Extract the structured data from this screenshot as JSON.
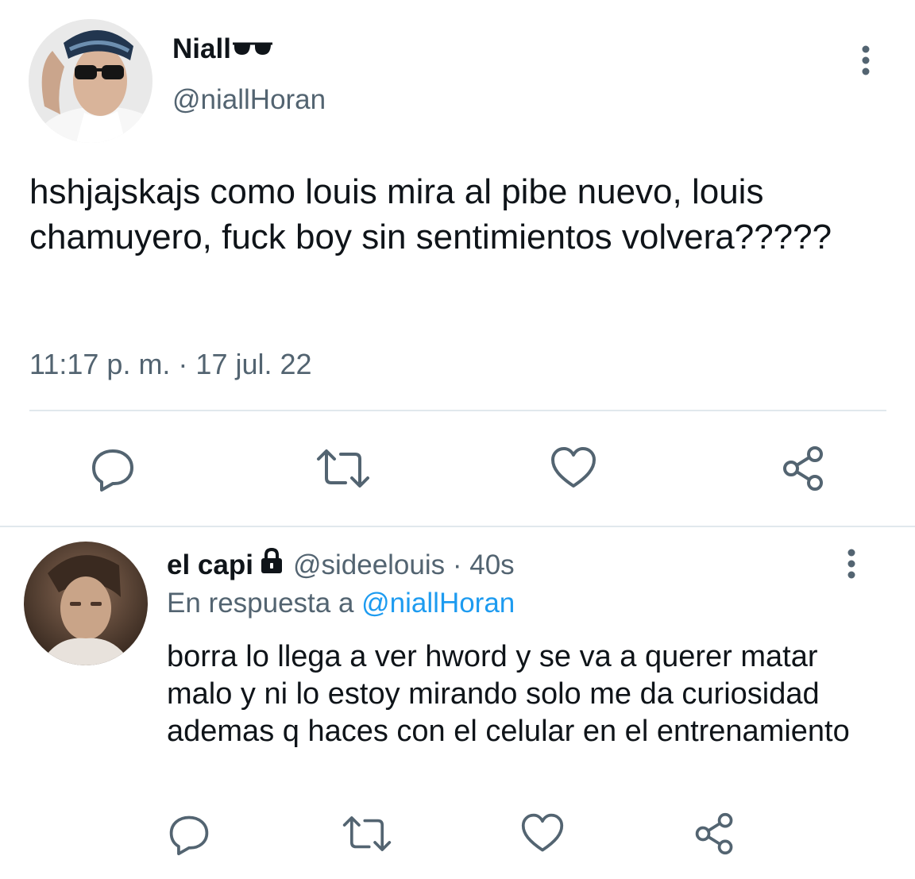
{
  "main_tweet": {
    "display_name": "Niall",
    "name_emoji": "sunglasses-icon",
    "handle": "@niallHoran",
    "text": "hshjajskajs como louis mira al pibe nuevo, louis chamuyero, fuck boy sin sentimientos volvera?????",
    "timestamp": "11:17 p. m. · 17 jul. 22",
    "actions": [
      "reply-icon",
      "retweet-icon",
      "like-icon",
      "share-icon"
    ]
  },
  "reply_tweet": {
    "display_name": "el capi",
    "badge": "lock-icon",
    "handle": "@sideelouis",
    "separator": " · ",
    "time": "40s",
    "in_reply_prefix": "En respuesta a ",
    "in_reply_mention": "@niallHoran",
    "text": "borra lo llega a ver hword y se va a querer matar malo y ni lo estoy mirando solo me da curiosidad ademas q haces con el celular en el entrenamiento",
    "actions": [
      "reply-icon",
      "retweet-icon",
      "like-icon",
      "share-icon"
    ]
  },
  "colors": {
    "text": "#0f1419",
    "secondary": "#536471",
    "link": "#1d9bf0",
    "divider": "#e1e8ed"
  }
}
